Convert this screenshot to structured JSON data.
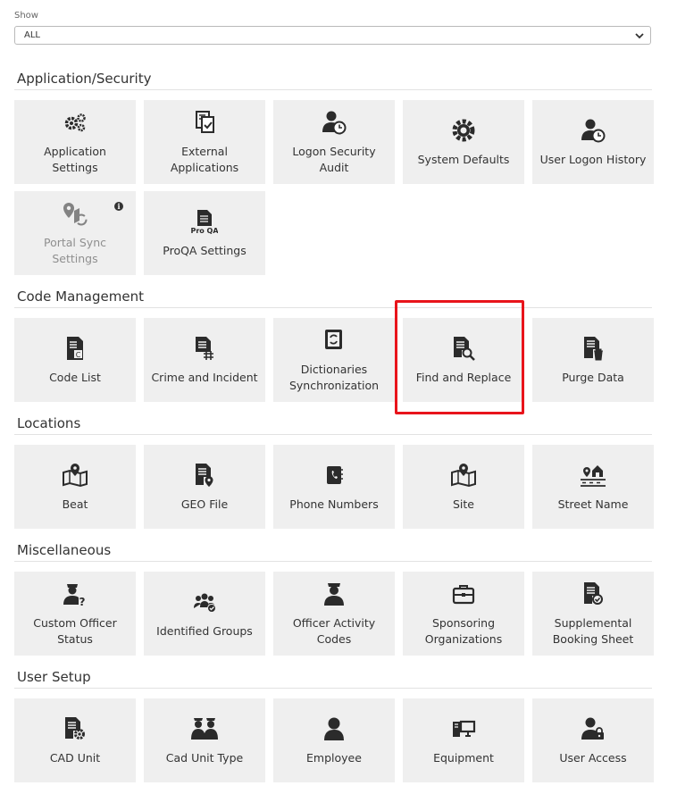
{
  "filter": {
    "label": "Show",
    "value": "ALL"
  },
  "sections": {
    "application_security": {
      "title": "Application/Security",
      "tiles": [
        {
          "label": "Application Settings",
          "icon": "gears-icon"
        },
        {
          "label": "External Applications",
          "icon": "external-doc-icon"
        },
        {
          "label": "Logon Security Audit",
          "icon": "user-clock-icon"
        },
        {
          "label": "System Defaults",
          "icon": "gear-icon"
        },
        {
          "label": "User Logon History",
          "icon": "user-clock-icon"
        },
        {
          "label": "Portal Sync Settings",
          "icon": "map-sync-icon",
          "disabled": true,
          "info_badge": "i"
        },
        {
          "label": "ProQA Settings",
          "icon": "proqa-doc-icon",
          "icon_text": "Pro QA"
        }
      ]
    },
    "code_management": {
      "title": "Code Management",
      "tiles": [
        {
          "label": "Code List",
          "icon": "code-list-icon"
        },
        {
          "label": "Crime and Incident",
          "icon": "doc-hash-icon"
        },
        {
          "label": "Dictionaries Synchronization",
          "icon": "book-sync-icon"
        },
        {
          "label": "Find and Replace",
          "icon": "doc-search-icon"
        },
        {
          "label": "Purge Data",
          "icon": "doc-trash-icon"
        }
      ]
    },
    "locations": {
      "title": "Locations",
      "tiles": [
        {
          "label": "Beat",
          "icon": "map-pin-icon"
        },
        {
          "label": "GEO File",
          "icon": "doc-pin-icon"
        },
        {
          "label": "Phone Numbers",
          "icon": "phone-book-icon"
        },
        {
          "label": "Site",
          "icon": "map-pin-icon"
        },
        {
          "label": "Street Name",
          "icon": "street-icon"
        }
      ]
    },
    "miscellaneous": {
      "title": "Miscellaneous",
      "tiles": [
        {
          "label": "Custom Officer Status",
          "icon": "officer-question-icon"
        },
        {
          "label": "Identified Groups",
          "icon": "group-check-icon"
        },
        {
          "label": "Officer Activity Codes",
          "icon": "officer-icon"
        },
        {
          "label": "Sponsoring Organizations",
          "icon": "briefcase-icon"
        },
        {
          "label": "Supplemental Booking Sheet",
          "icon": "doc-check-icon"
        }
      ]
    },
    "user_setup": {
      "title": "User Setup",
      "tiles": [
        {
          "label": "CAD Unit",
          "icon": "doc-gear-icon"
        },
        {
          "label": "Cad Unit Type",
          "icon": "officers-icon"
        },
        {
          "label": "Employee",
          "icon": "user-icon"
        },
        {
          "label": "Equipment",
          "icon": "computer-icon"
        },
        {
          "label": "User Access",
          "icon": "user-lock-icon"
        }
      ]
    }
  },
  "colors": {
    "tile_bg": "#efefef",
    "highlight": "#e8141b",
    "icon": "#2b2b2b"
  }
}
